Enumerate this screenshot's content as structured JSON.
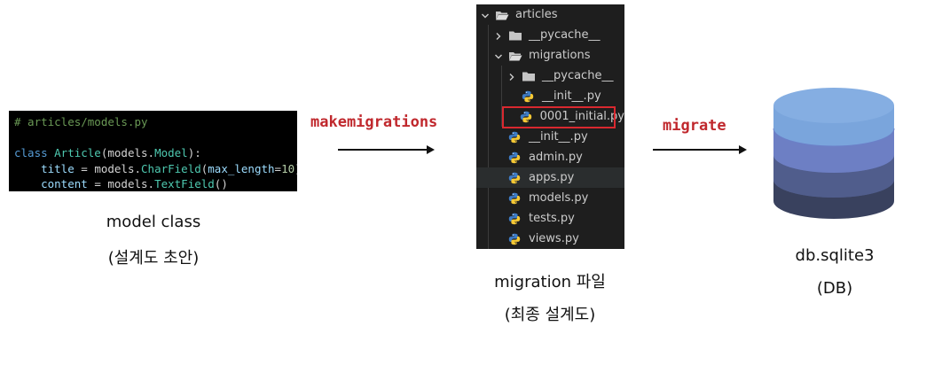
{
  "code": {
    "lines": [
      [
        {
          "t": "# articles/models.py",
          "c": "comment"
        }
      ],
      [],
      [
        {
          "t": "class ",
          "c": "kw"
        },
        {
          "t": "Article",
          "c": "cls"
        },
        {
          "t": "(models.",
          "c": "plain"
        },
        {
          "t": "Model",
          "c": "cls"
        },
        {
          "t": "):",
          "c": "plain"
        }
      ],
      [
        {
          "t": "    ",
          "c": "plain"
        },
        {
          "t": "title",
          "c": "var"
        },
        {
          "t": " = models.",
          "c": "plain"
        },
        {
          "t": "CharField",
          "c": "cls"
        },
        {
          "t": "(",
          "c": "plain"
        },
        {
          "t": "max_length",
          "c": "var"
        },
        {
          "t": "=",
          "c": "plain"
        },
        {
          "t": "10",
          "c": "num"
        },
        {
          "t": ")",
          "c": "plain"
        }
      ],
      [
        {
          "t": "    ",
          "c": "plain"
        },
        {
          "t": "content",
          "c": "var"
        },
        {
          "t": " = models.",
          "c": "plain"
        },
        {
          "t": "TextField",
          "c": "cls"
        },
        {
          "t": "()",
          "c": "plain"
        }
      ]
    ]
  },
  "model_caption": {
    "line1": "model class",
    "line2": "(설계도 초안)"
  },
  "makemigrations_label": "makemigrations",
  "migrate_label": "migrate",
  "explorer": {
    "items": [
      {
        "label": "articles",
        "depth": 0,
        "kind": "folder-open",
        "chevron": "down"
      },
      {
        "label": "__pycache__",
        "depth": 1,
        "kind": "folder",
        "chevron": "right"
      },
      {
        "label": "migrations",
        "depth": 1,
        "kind": "folder-open",
        "chevron": "down"
      },
      {
        "label": "__pycache__",
        "depth": 2,
        "kind": "folder",
        "chevron": "right"
      },
      {
        "label": "__init__.py",
        "depth": 2,
        "kind": "python"
      },
      {
        "label": "0001_initial.py",
        "depth": 2,
        "kind": "python",
        "selected": true
      },
      {
        "label": "__init__.py",
        "depth": 1,
        "kind": "python"
      },
      {
        "label": "admin.py",
        "depth": 1,
        "kind": "python"
      },
      {
        "label": "apps.py",
        "depth": 1,
        "kind": "python",
        "hover": true
      },
      {
        "label": "models.py",
        "depth": 1,
        "kind": "python"
      },
      {
        "label": "tests.py",
        "depth": 1,
        "kind": "python"
      },
      {
        "label": "views.py",
        "depth": 1,
        "kind": "python"
      }
    ]
  },
  "migration_caption": {
    "line1": "migration 파일",
    "line2": "(최종 설계도)"
  },
  "db_caption": {
    "line1": "db.sqlite3",
    "line2": "(DB)"
  },
  "colors": {
    "command": "#c0282d",
    "db_top": "#7aa5dc",
    "db_mid": "#6d7fc4",
    "db_low": "#505d8c",
    "db_bottom": "#39415e"
  }
}
